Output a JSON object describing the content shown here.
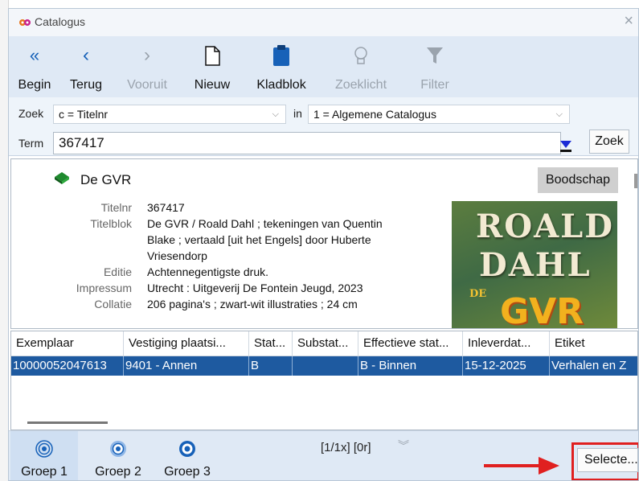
{
  "window": {
    "title": "Catalogus",
    "close_symbol": "×"
  },
  "toolbar": {
    "items": [
      {
        "label": "Begin",
        "icon": "double-chevron-left-icon",
        "enabled": true
      },
      {
        "label": "Terug",
        "icon": "chevron-left-icon",
        "enabled": true
      },
      {
        "label": "Vooruit",
        "icon": "chevron-right-icon",
        "enabled": false
      },
      {
        "label": "Nieuw",
        "icon": "new-document-icon",
        "enabled": true
      },
      {
        "label": "Kladblok",
        "icon": "clipboard-icon",
        "enabled": true
      },
      {
        "label": "Zoeklicht",
        "icon": "lightbulb-icon",
        "enabled": false
      },
      {
        "label": "Filter",
        "icon": "filter-icon",
        "enabled": false
      }
    ]
  },
  "search": {
    "zoek_label": "Zoek",
    "zoek_value": "c = Titelnr",
    "in_label": "in",
    "catalog_value": "1 = Algemene Catalogus",
    "term_label": "Term",
    "term_value": "367417",
    "button_label": "Zoek"
  },
  "detail": {
    "title": "De GVR",
    "message_button": "Boodschap",
    "fields": [
      {
        "label": "Titelnr",
        "value": "367417"
      },
      {
        "label": "Titelblok",
        "value_lines": [
          "De GVR / Roald Dahl ; tekeningen van Quentin",
          "Blake ; vertaald [uit het Engels] door Huberte",
          "Vriesendorp"
        ]
      },
      {
        "label": "Editie",
        "value": "Achtennegentigste druk."
      },
      {
        "label": "Impressum",
        "value": "Utrecht : Uitgeverij De Fontein Jeugd, 2023"
      },
      {
        "label": "Collatie",
        "value": "206 pagina's ; zwart-wit illustraties ; 24 cm"
      }
    ],
    "cover": {
      "line1": "ROALD",
      "line2": "DAHL",
      "de": "DE",
      "gvr": "GVR"
    }
  },
  "copies": {
    "columns": [
      "Exemplaar",
      "Vestiging plaatsi...",
      "Stat...",
      "Substat...",
      "Effectieve stat...",
      "Inleverdat...",
      "Etiket"
    ],
    "rows": [
      [
        "10000052047613",
        "9401 - Annen",
        "B",
        "",
        "B - Binnen",
        "15-12-2025",
        "Verhalen en Z"
      ]
    ]
  },
  "footer": {
    "groups": [
      "Groep 1",
      "Groep 2",
      "Groep 3"
    ],
    "paging": "[1/1x] [0r]",
    "select_button": "Selecte..."
  },
  "colors": {
    "accent": "#1761b8",
    "selection": "#1e5aa0",
    "highlight": "#e02020",
    "toolbar_bg": "#dfe9f5"
  }
}
